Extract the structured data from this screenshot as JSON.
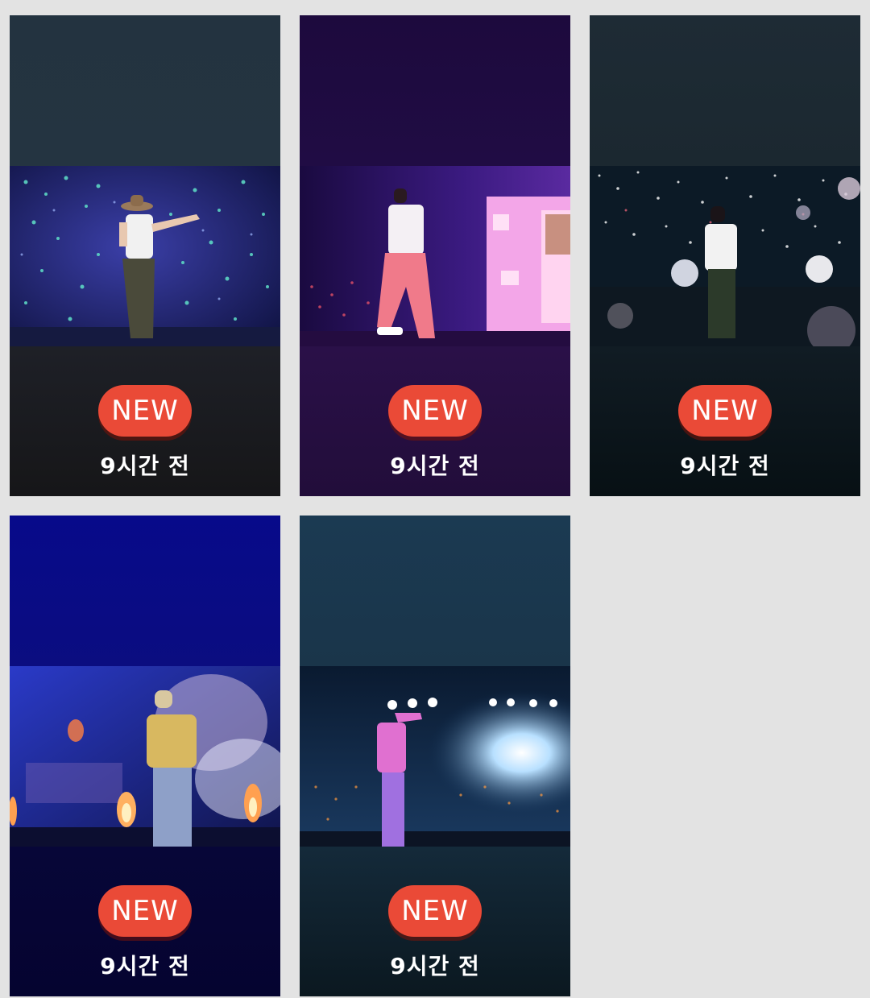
{
  "cards": [
    {
      "badge": "NEW",
      "time": "9시간 전",
      "top_color": "#243440",
      "bottom_color": "#1a1c20",
      "photo_icon": "concert-photo-cowboy-hat"
    },
    {
      "badge": "NEW",
      "time": "9시간 전",
      "top_color": "#1e0b40",
      "bottom_color": "#25103d",
      "photo_icon": "concert-photo-pink-outfit"
    },
    {
      "badge": "NEW",
      "time": "9시간 전",
      "top_color": "#1d2b35",
      "bottom_color": "#0b1418",
      "photo_icon": "concert-photo-confetti-balloons"
    },
    {
      "badge": "NEW",
      "time": "9시간 전",
      "top_color": "#080a88",
      "bottom_color": "#070535",
      "photo_icon": "concert-photo-yellow-jacket"
    },
    {
      "badge": "NEW",
      "time": "9시간 전",
      "top_color": "#1c3a50",
      "bottom_color": "#0c1a24",
      "photo_icon": "concert-photo-stage-lights"
    }
  ]
}
